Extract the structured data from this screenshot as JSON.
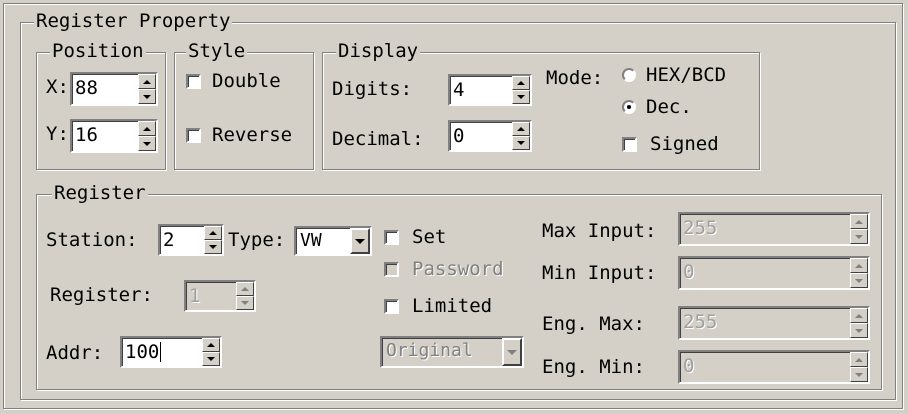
{
  "register_property": {
    "title": "Register Property"
  },
  "position": {
    "title": "Position",
    "x_label": "X:",
    "x_value": "88",
    "y_label": "Y:",
    "y_value": "16"
  },
  "style": {
    "title": "Style",
    "double_label": "Double",
    "double_checked": false,
    "reverse_label": "Reverse",
    "reverse_checked": false
  },
  "display": {
    "title": "Display",
    "digits_label": "Digits:",
    "digits_value": "4",
    "decimal_label": "Decimal:",
    "decimal_value": "0",
    "mode_label": "Mode:",
    "mode_options": [
      "HEX/BCD",
      "Dec."
    ],
    "mode_selected": "Dec.",
    "signed_label": "Signed",
    "signed_checked": false
  },
  "register": {
    "title": "Register",
    "station_label": "Station:",
    "station_value": "2",
    "type_label": "Type:",
    "type_value": "VW",
    "register_label": "Register:",
    "register_value": "1",
    "addr_label": "Addr:",
    "addr_value": "100",
    "set_label": "Set",
    "set_checked": false,
    "password_label": "Password",
    "password_checked": false,
    "limited_label": "Limited",
    "limited_checked": false,
    "conversion_value": "Original",
    "max_input_label": "Max Input:",
    "max_input_value": "255",
    "min_input_label": "Min Input:",
    "min_input_value": "0",
    "eng_max_label": "Eng. Max:",
    "eng_max_value": "255",
    "eng_min_label": "Eng. Min:",
    "eng_min_value": "0"
  },
  "colors": {
    "face": "#d4d0c8",
    "shadow": "#808080",
    "highlight": "#ffffff",
    "disabled_text": "#808080"
  }
}
